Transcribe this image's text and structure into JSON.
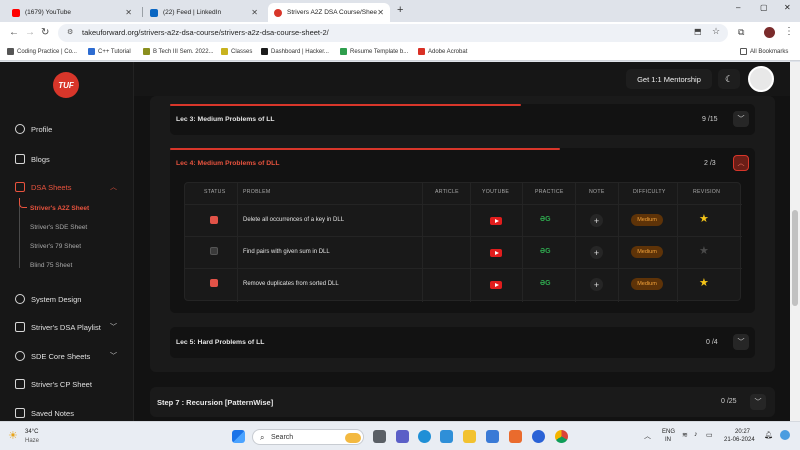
{
  "browser": {
    "tabs": [
      {
        "label": "(1679) YouTube",
        "color": "#ff0000"
      },
      {
        "label": "(22) Feed | LinkedIn",
        "color": "#0a66c2"
      },
      {
        "label": "Strivers A2Z DSA Course/Shee",
        "color": "#d8362a"
      }
    ],
    "new_tab": "+",
    "win_min": "–",
    "win_max": "▢",
    "win_close": "✕",
    "url": "takeuforward.org/strivers-a2z-dsa-course/strivers-a2z-dsa-course-sheet-2/",
    "bookmarks": [
      {
        "label": "Coding Practice | Co...",
        "color": "#555555"
      },
      {
        "label": "C++ Tutorial",
        "color": "#2d6cd1"
      },
      {
        "label": "B Tech III Sem. 2022...",
        "color": "#8a8f1e"
      },
      {
        "label": "Classes",
        "color": "#c8b21e"
      },
      {
        "label": "Dashboard | Hacker...",
        "color": "#1b1b1b"
      },
      {
        "label": "Resume Template b...",
        "color": "#2e9e4d"
      },
      {
        "label": "Adobe Acrobat",
        "color": "#d93025"
      }
    ],
    "all_bookmarks": "All Bookmarks"
  },
  "site": {
    "logo": "TUF",
    "mentorship_button": "Get 1:1 Mentorship",
    "sidebar": {
      "profile": "Profile",
      "blogs": "Blogs",
      "dsa_sheets": "DSA Sheets",
      "sheets": [
        "Striver's A2Z Sheet",
        "Striver's SDE Sheet",
        "Striver's 79 Sheet",
        "Blind 75 Sheet"
      ],
      "system_design": "System Design",
      "dsa_playlist": "Striver's DSA Playlist",
      "sde_core": "SDE Core Sheets",
      "cp_sheet": "Striver's CP Sheet",
      "saved_notes": "Saved Notes"
    }
  },
  "main": {
    "lec3": {
      "title": "Lec 3: Medium Problems of LL",
      "progress": "9 /15",
      "progress_fraction": 0.6
    },
    "lec4": {
      "title": "Lec 4: Medium Problems of DLL",
      "progress": "2 /3",
      "progress_fraction": 0.667
    },
    "lec5": {
      "title": "Lec 5: Hard Problems of LL",
      "progress": "0 /4"
    },
    "step7": {
      "title": "Step 7 : Recursion [PatternWise]",
      "progress": "0 /25"
    },
    "table": {
      "headers": [
        "STATUS",
        "PROBLEM",
        "ARTICLE",
        "YOUTUBE",
        "PRACTICE",
        "NOTE",
        "DIFFICULTY",
        "REVISION"
      ],
      "rows": [
        {
          "done": true,
          "problem": "Delete all occurrences of a key in DLL",
          "difficulty": "Medium",
          "starred": true
        },
        {
          "done": false,
          "problem": "Find pairs with given sum in DLL",
          "difficulty": "Medium",
          "starred": false
        },
        {
          "done": true,
          "problem": "Remove duplicates from sorted DLL",
          "difficulty": "Medium",
          "starred": true
        }
      ],
      "practice_glyph": "ƏG",
      "note_glyph": "+",
      "star_glyph": "★"
    }
  },
  "taskbar": {
    "weather_temp": "34°C",
    "weather_desc": "Haze",
    "search_placeholder": "Search",
    "lang": "ENG",
    "region": "IN",
    "time": "20:27",
    "date": "21-06-2024"
  },
  "colors": {
    "accent": "#d8362a",
    "medium_badge": "#f2a23a",
    "star_on": "#f5c518",
    "star_off": "#4a4a4a"
  }
}
